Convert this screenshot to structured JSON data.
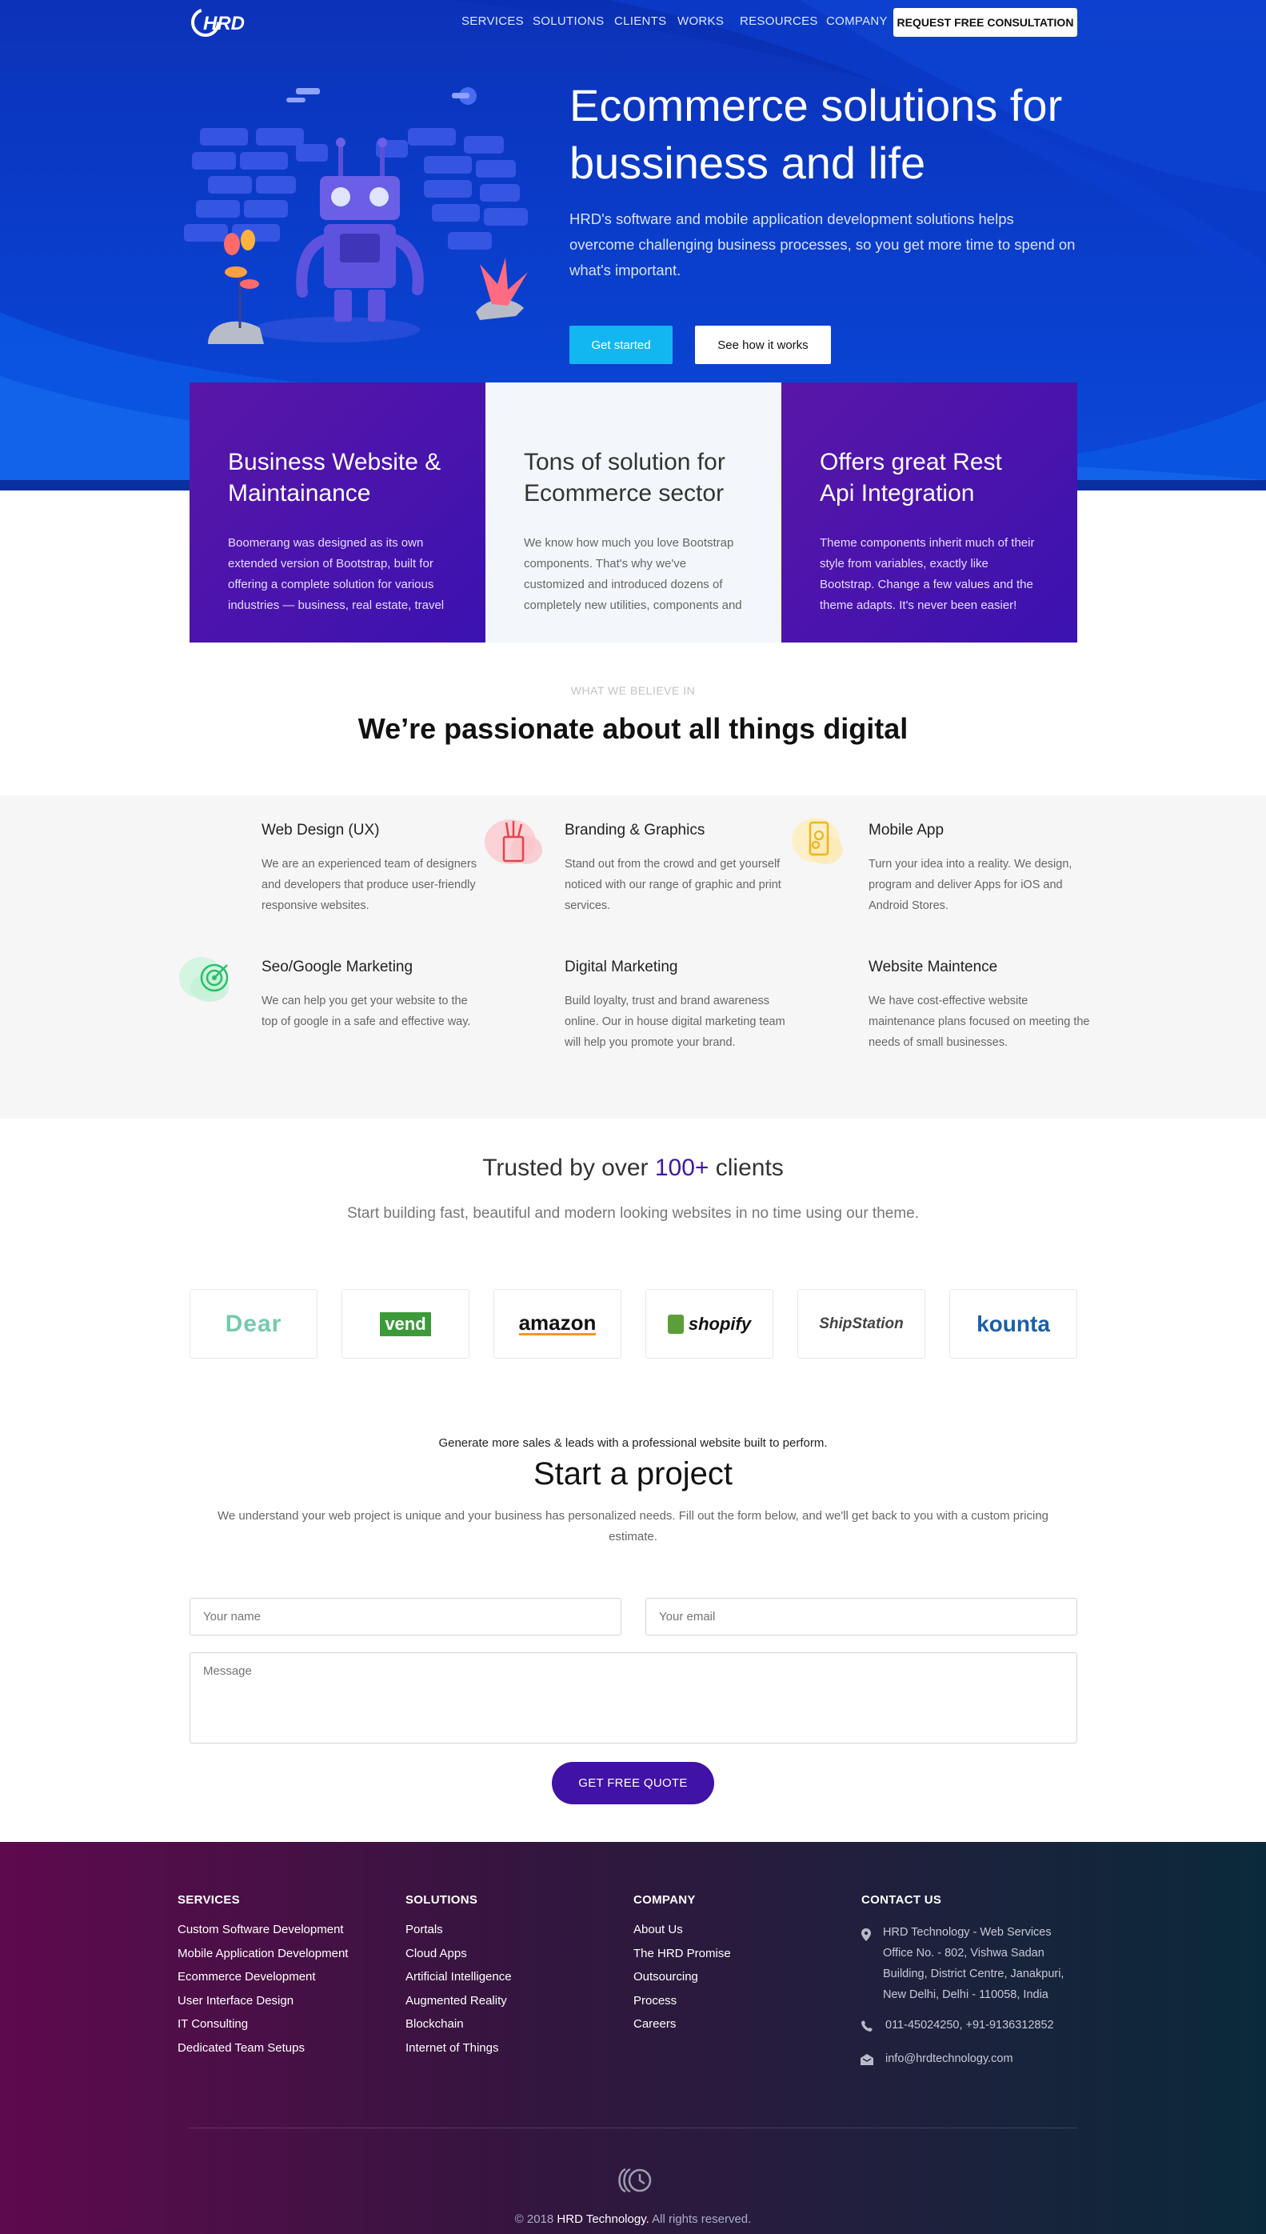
{
  "nav": {
    "brand": "HRD",
    "items": [
      "SERVICES",
      "SOLUTIONS",
      "CLIENTS",
      "WORKS",
      "RESOURCES",
      "COMPANY"
    ],
    "cta": "REQUEST FREE CONSULTATION"
  },
  "hero": {
    "title": "Ecommerce solutions for bussiness and life",
    "subtitle": "HRD's software and mobile application development solutions helps overcome challenging business processes, so you get more time to spend on what's important.",
    "primary_button": "Get started",
    "secondary_button": "See how it works"
  },
  "features": [
    {
      "title": "Business Website & Maintainance",
      "text": "Boomerang was designed as its own extended version of Bootstrap, built for offering a complete solution for various industries — business, real estate, travel and much more."
    },
    {
      "title": "Tons of solution for Ecommerce sector",
      "text": "We know how much you love Bootstrap components. That's why we've customized and introduced dozens of completely new utilities, components and plugins."
    },
    {
      "title": "Offers great Rest Api Integration",
      "text": "Theme components inherit much of their style from variables, exactly like Bootstrap. Change a few values and the theme adapts. It's never been easier!"
    }
  ],
  "believe": {
    "eyebrow": "WHAT WE BELIEVE IN",
    "title": "We’re passionate about all things digital"
  },
  "services": [
    {
      "title": "Web Design (UX)",
      "text": "We are an experienced team of designers and developers that produce user-friendly responsive websites.",
      "icon": "none"
    },
    {
      "title": "Branding & Graphics",
      "text": "Stand out from the crowd and get yourself noticed with our range of graphic and print services.",
      "icon": "pencil-cup-icon"
    },
    {
      "title": "Mobile App",
      "text": "Turn your idea into a reality. We design, program and deliver Apps for iOS and Android Stores.",
      "icon": "mobile-settings-icon"
    },
    {
      "title": "Seo/Google Marketing",
      "text": "We can help you get your website to the top of google in a safe and effective way.",
      "icon": "target-icon"
    },
    {
      "title": "Digital Marketing",
      "text": "Build loyalty, trust and brand awareness online. Our in house digital marketing team will help you promote your brand.",
      "icon": "none"
    },
    {
      "title": "Website Maintence",
      "text": "We have cost-effective website maintenance plans focused on meeting the needs of small businesses.",
      "icon": "none"
    }
  ],
  "trusted": {
    "prefix": "Trusted by over ",
    "highlight": "100+",
    "suffix": " clients",
    "subtitle": "Start building fast, beautiful and modern looking websites in no time using our theme."
  },
  "clients": [
    "Dear",
    "vend",
    "amazon",
    "shopify",
    "ShipStation",
    "kounta"
  ],
  "project": {
    "kicker": "Generate more sales & leads with a professional website built to perform.",
    "title": "Start a project",
    "text": "We understand your web project is unique and your business has personalized needs. Fill out the form below, and we'll get back to you with a custom pricing estimate.",
    "name_placeholder": "Your name",
    "email_placeholder": "Your email",
    "message_placeholder": "Message",
    "submit": "GET FREE QUOTE"
  },
  "footer": {
    "services": {
      "heading": "SERVICES",
      "links": [
        "Custom Software Development",
        "Mobile Application Development",
        "Ecommerce Development",
        "User Interface Design",
        "IT Consulting",
        "Dedicated Team Setups"
      ]
    },
    "solutions": {
      "heading": "SOLUTIONS",
      "links": [
        "Portals",
        "Cloud Apps",
        "Artificial Intelligence",
        "Augmented Reality",
        "Blockchain",
        "Internet of Things"
      ]
    },
    "company": {
      "heading": "COMPANY",
      "links": [
        "About Us",
        "The HRD Promise",
        "Outsourcing",
        "Process",
        "Careers"
      ]
    },
    "contact": {
      "heading": "CONTACT US",
      "address_lines": [
        "HRD Technology - Web Services",
        "Office No. - 802, Vishwa Sadan",
        "Building, District Centre, Janakpuri,",
        "New Delhi, Delhi - 110058, India"
      ],
      "phone": "011-45024250, +91-9136312852",
      "email": "info@hrdtechnology.com"
    },
    "copyright_prefix": "© 2018 ",
    "copyright_brand": "HRD Technology.",
    "copyright_suffix": " All rights reserved."
  },
  "colors": {
    "hero_blue": "#0a3cc9",
    "accent_purple": "#4316a5",
    "button_cyan": "#12b7f2"
  }
}
